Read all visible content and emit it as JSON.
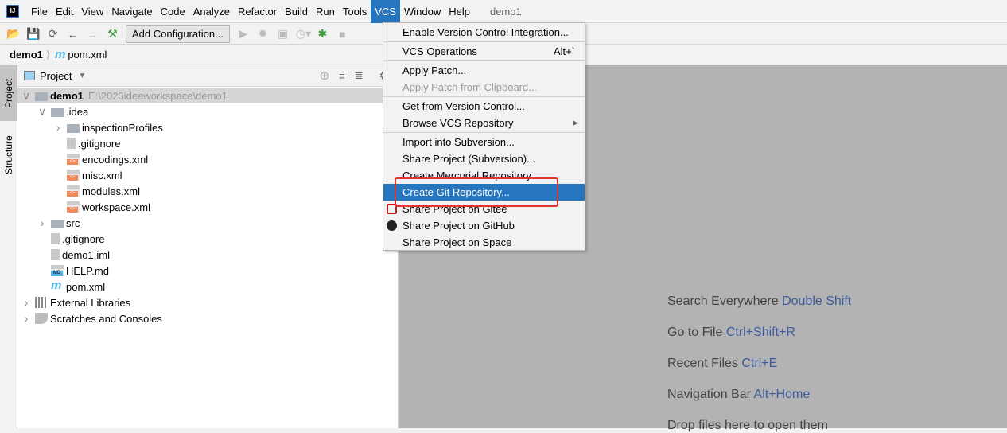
{
  "menubar": {
    "items": [
      "File",
      "Edit",
      "View",
      "Navigate",
      "Code",
      "Analyze",
      "Refactor",
      "Build",
      "Run",
      "Tools",
      "VCS",
      "Window",
      "Help"
    ],
    "active": "VCS",
    "project_title": "demo1"
  },
  "toolbar": {
    "add_configuration": "Add Configuration..."
  },
  "breadcrumb": {
    "project": "demo1",
    "file": "pom.xml"
  },
  "stripe": {
    "project_tab": "Project",
    "structure_tab": "Structure"
  },
  "panel": {
    "title": "Project"
  },
  "tree": [
    {
      "label": "demo1",
      "path": "E:\\2023ideaworkspace\\demo1",
      "depth": 0,
      "arrow": "down",
      "icon": "module-folder",
      "bold": true,
      "selected": true
    },
    {
      "label": ".idea",
      "depth": 1,
      "arrow": "down",
      "icon": "folder"
    },
    {
      "label": "inspectionProfiles",
      "depth": 2,
      "arrow": "right",
      "icon": "folder"
    },
    {
      "label": ".gitignore",
      "depth": 2,
      "icon": "ignore-file"
    },
    {
      "label": "encodings.xml",
      "depth": 2,
      "icon": "xml-file"
    },
    {
      "label": "misc.xml",
      "depth": 2,
      "icon": "xml-file"
    },
    {
      "label": "modules.xml",
      "depth": 2,
      "icon": "xml-file"
    },
    {
      "label": "workspace.xml",
      "depth": 2,
      "icon": "xml-file"
    },
    {
      "label": "src",
      "depth": 1,
      "arrow": "right",
      "icon": "folder"
    },
    {
      "label": ".gitignore",
      "depth": 1,
      "icon": "ignore-file"
    },
    {
      "label": "demo1.iml",
      "depth": 1,
      "icon": "iml-file"
    },
    {
      "label": "HELP.md",
      "depth": 1,
      "icon": "md-file"
    },
    {
      "label": "pom.xml",
      "depth": 1,
      "icon": "maven-file"
    },
    {
      "label": "External Libraries",
      "depth": 0,
      "arrow": "right",
      "icon": "libraries"
    },
    {
      "label": "Scratches and Consoles",
      "depth": 0,
      "arrow": "right",
      "icon": "scratches"
    }
  ],
  "editor_hints": [
    {
      "text": "Search Everywhere",
      "key": "Double Shift"
    },
    {
      "text": "Go to File",
      "key": "Ctrl+Shift+R"
    },
    {
      "text": "Recent Files",
      "key": "Ctrl+E"
    },
    {
      "text": "Navigation Bar",
      "key": "Alt+Home"
    },
    {
      "text": "Drop files here to open them",
      "key": ""
    }
  ],
  "vcs_menu": [
    {
      "label": "Enable Version Control Integration..."
    },
    {
      "sep": true
    },
    {
      "label": "VCS Operations",
      "shortcut": "Alt+`"
    },
    {
      "sep": true
    },
    {
      "label": "Apply Patch..."
    },
    {
      "label": "Apply Patch from Clipboard...",
      "disabled": true
    },
    {
      "sep": true
    },
    {
      "label": "Get from Version Control..."
    },
    {
      "label": "Browse VCS Repository",
      "submenu": true
    },
    {
      "sep": true
    },
    {
      "label": "Import into Subversion..."
    },
    {
      "label": "Share Project (Subversion)..."
    },
    {
      "label": "Create Mercurial Repository"
    },
    {
      "label": "Create Git Repository...",
      "highlighted": true
    },
    {
      "label": "Share Project on Gitee",
      "icon": "gitee-icon"
    },
    {
      "label": "Share Project on GitHub",
      "icon": "github-icon"
    },
    {
      "label": "Share Project on Space"
    }
  ],
  "colors": {
    "accent": "#2675bf",
    "annotation": "#e5332a",
    "shortcut": "#3d5c9e",
    "editor_bg": "#b3b3b3"
  }
}
